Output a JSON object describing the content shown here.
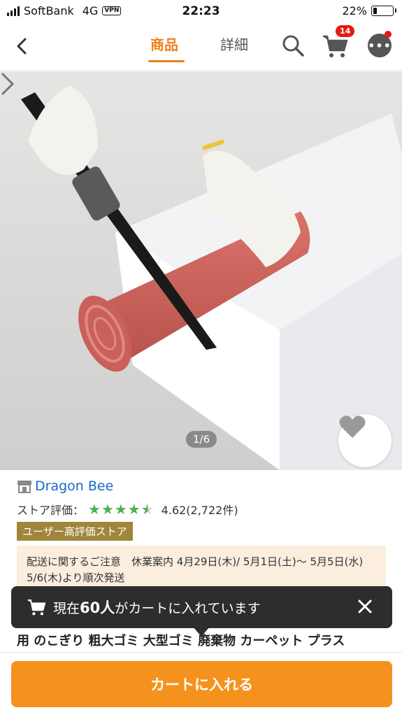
{
  "status_bar": {
    "carrier": "SoftBank",
    "network": "4G",
    "vpn": "VPN",
    "time": "22:23",
    "battery": "22%"
  },
  "nav": {
    "tab_product": "商品",
    "tab_detail": "詳細",
    "cart_count": "14"
  },
  "hero": {
    "counter": "1/6"
  },
  "store": {
    "name": "Dragon Bee",
    "rating_label": "ストア評価：",
    "rating_value": "4.62(2,722件)",
    "stars": 4.62,
    "badge": "ユーザー高評価ストア"
  },
  "notice": {
    "text": "配送に関するご注意　休業案内 4月29日(木)/ 5月1日(土)～ 5月5日(水)　5/6(木)より順次発送"
  },
  "toast": {
    "prefix": "現在",
    "count": "60人",
    "suffix": "がカートに入れています"
  },
  "product": {
    "title_fragment": "用 のこぎり 粗大ゴミ 大型ゴミ 廃棄物 カーペット プラス"
  },
  "bottom": {
    "add_to_cart": "カートに入れる"
  },
  "colors": {
    "accent": "#f07e19",
    "cart_button": "#f5921e",
    "store_link": "#1b66c9",
    "star": "#4caf50",
    "badge_bg": "#a0853b",
    "notice_bg": "#fbeedf"
  }
}
